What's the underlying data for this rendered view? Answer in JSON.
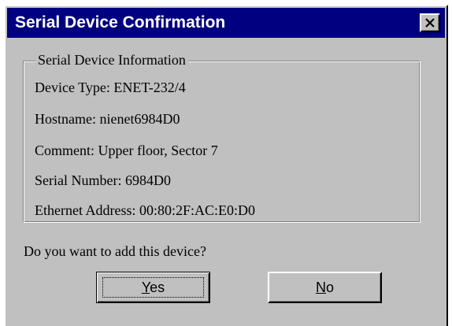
{
  "window": {
    "title": "Serial Device Confirmation",
    "close_icon": "close-icon"
  },
  "group": {
    "legend": "Serial Device Information",
    "lines": [
      "Device Type: ENET-232/4",
      "Hostname: nienet6984D0",
      "Comment: Upper floor, Sector 7",
      "Serial Number: 6984D0",
      "Ethernet Address:  00:80:2F:AC:E0:D0"
    ]
  },
  "question": "Do you want to add this device?",
  "buttons": {
    "yes": {
      "mnemonic": "Y",
      "rest": "es"
    },
    "no": {
      "mnemonic": "N",
      "rest": "o"
    }
  },
  "colors": {
    "dialog_face": "#c0c0c0",
    "titlebar": "#000080",
    "title_text": "#ffffff"
  }
}
